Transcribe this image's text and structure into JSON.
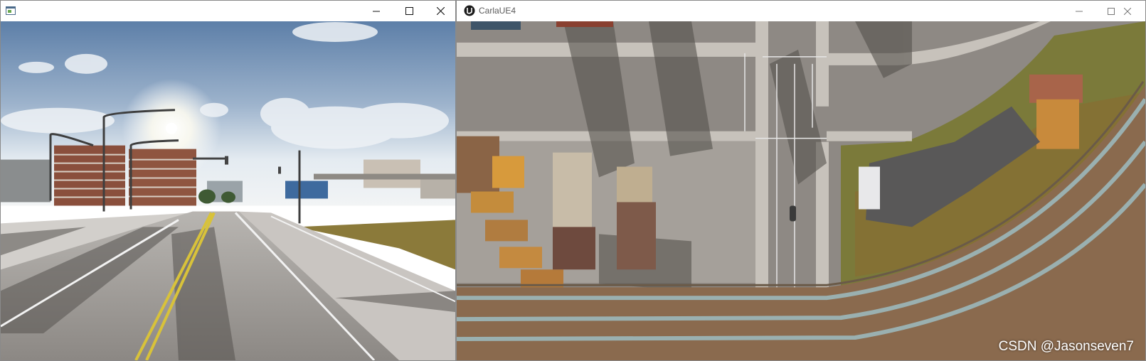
{
  "left_window": {
    "title": "",
    "icon": "generic-window-icon",
    "controls": {
      "minimize_icon": "minimize-icon",
      "maximize_icon": "maximize-icon",
      "close_icon": "close-icon"
    },
    "view": "front-camera-street-view"
  },
  "right_window": {
    "title": "CarlaUE4",
    "icon": "unreal-engine-icon",
    "controls": {
      "minimize_icon": "minimize-icon",
      "maximize_icon": "maximize-icon",
      "close_icon": "close-icon"
    },
    "view": "top-down-city-view"
  },
  "watermark": "CSDN @Jasonseven7",
  "colors": {
    "titlebar_bg": "#ffffff",
    "sky_top": "#6f8fb5",
    "sky_horizon": "#dfe7ef",
    "road": "#8f8b86",
    "grass": "#7a7a3a",
    "lane_yellow": "#d8c23a"
  }
}
